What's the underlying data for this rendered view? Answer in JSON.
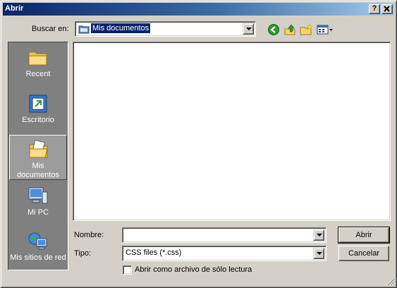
{
  "window": {
    "title": "Abrir",
    "help_label": "?",
    "close_label": "✕"
  },
  "toolbar": {
    "lookin_label": "Buscar en:",
    "lookin_value": "Mis documentos",
    "icons": [
      "back-icon",
      "up-folder-icon",
      "new-folder-icon",
      "view-menu-icon"
    ]
  },
  "places": [
    {
      "label": "Recent",
      "icon": "recent-folder-icon"
    },
    {
      "label": "Escritorio",
      "icon": "desktop-icon"
    },
    {
      "label": "Mis documentos",
      "line1": "Mis",
      "line2": "documentos",
      "icon": "my-documents-icon",
      "active": true
    },
    {
      "label": "Mi PC",
      "icon": "my-computer-icon"
    },
    {
      "label": "Mis sitios de red",
      "icon": "network-places-icon"
    }
  ],
  "file_list": {
    "items": []
  },
  "footer": {
    "filename_label": "Nombre:",
    "filename_value": "",
    "filetype_label": "Tipo:",
    "filetype_value": "CSS files (*.css)",
    "readonly_label": "Abrir como archivo de sólo lectura",
    "readonly_checked": false,
    "open_button": "Abrir",
    "cancel_button": "Cancelar"
  },
  "colors": {
    "titlebar_start": "#0a246a",
    "titlebar_end": "#a6caf0",
    "face": "#d4d0c8",
    "places_bg": "#808080"
  }
}
